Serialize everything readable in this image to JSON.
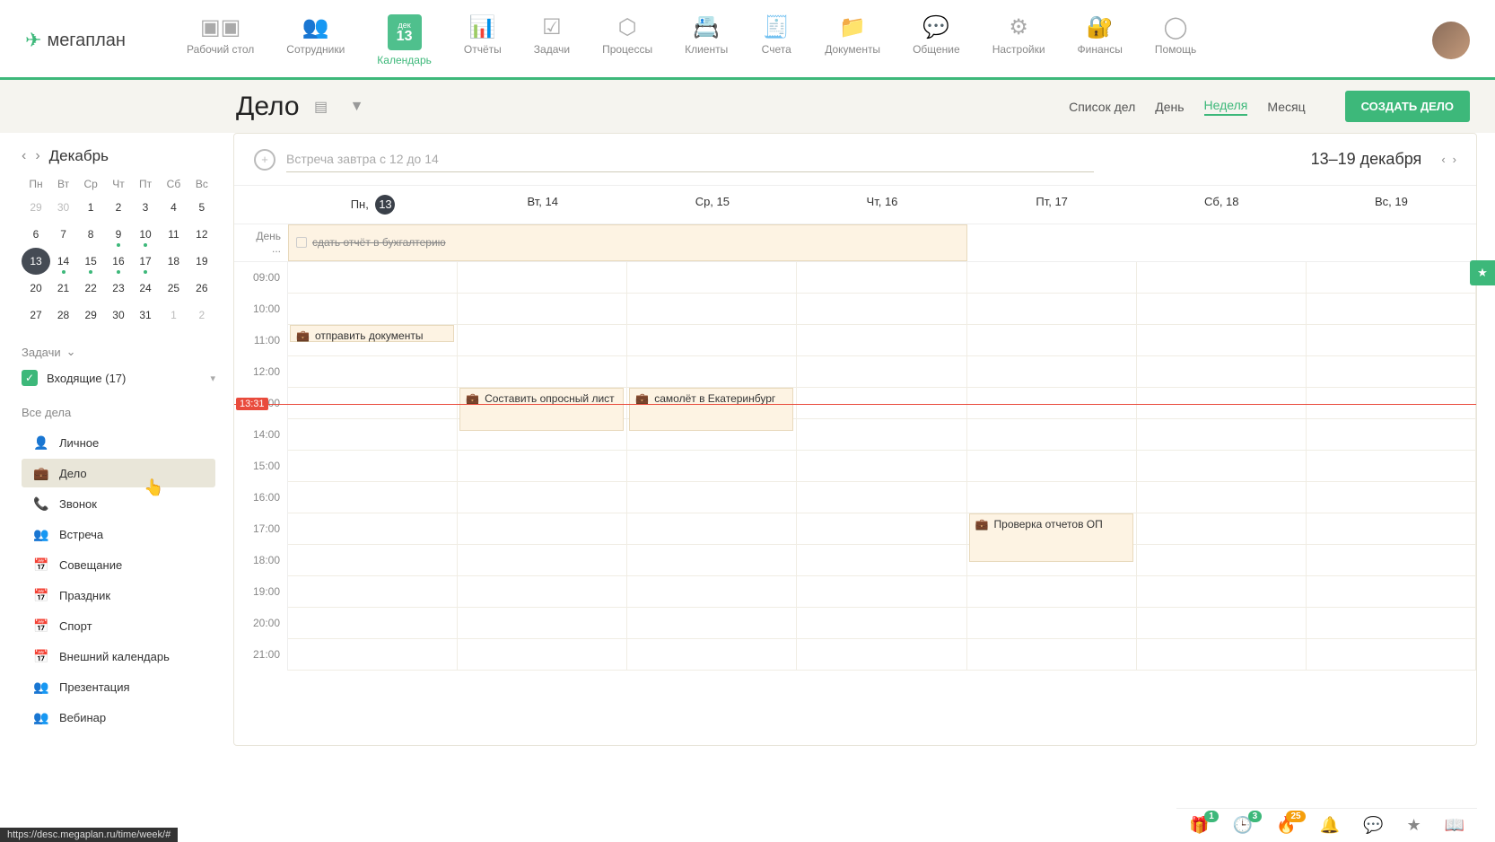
{
  "app": {
    "logo": "мегаплан"
  },
  "nav": [
    {
      "id": "desktop",
      "label": "Рабочий стол"
    },
    {
      "id": "staff",
      "label": "Сотрудники"
    },
    {
      "id": "calendar",
      "label": "Календарь",
      "active": true,
      "cal_month": "дек",
      "cal_day": "13"
    },
    {
      "id": "reports",
      "label": "Отчёты"
    },
    {
      "id": "tasks",
      "label": "Задачи"
    },
    {
      "id": "processes",
      "label": "Процессы"
    },
    {
      "id": "clients",
      "label": "Клиенты"
    },
    {
      "id": "invoices",
      "label": "Счета"
    },
    {
      "id": "documents",
      "label": "Документы"
    },
    {
      "id": "chat",
      "label": "Общение"
    },
    {
      "id": "settings",
      "label": "Настройки"
    },
    {
      "id": "finance",
      "label": "Финансы"
    },
    {
      "id": "help",
      "label": "Помощь"
    }
  ],
  "page": {
    "title": "Дело"
  },
  "view_tabs": {
    "list": "Список дел",
    "day": "День",
    "week": "Неделя",
    "month": "Месяц",
    "active": "week"
  },
  "create_button": "СОЗДАТЬ ДЕЛО",
  "sidebar": {
    "month": "Декабрь",
    "dow": [
      "Пн",
      "Вт",
      "Ср",
      "Чт",
      "Пт",
      "Сб",
      "Вс"
    ],
    "weeks": [
      [
        {
          "d": "29",
          "m": true
        },
        {
          "d": "30",
          "m": true
        },
        {
          "d": "1"
        },
        {
          "d": "2"
        },
        {
          "d": "3"
        },
        {
          "d": "4"
        },
        {
          "d": "5"
        }
      ],
      [
        {
          "d": "6"
        },
        {
          "d": "7"
        },
        {
          "d": "8"
        },
        {
          "d": "9",
          "dot": true
        },
        {
          "d": "10",
          "dot": true
        },
        {
          "d": "11"
        },
        {
          "d": "12"
        }
      ],
      [
        {
          "d": "13",
          "today": true
        },
        {
          "d": "14",
          "dot": true
        },
        {
          "d": "15",
          "dot": true
        },
        {
          "d": "16",
          "dot": true
        },
        {
          "d": "17",
          "dot": true
        },
        {
          "d": "18"
        },
        {
          "d": "19"
        }
      ],
      [
        {
          "d": "20"
        },
        {
          "d": "21"
        },
        {
          "d": "22"
        },
        {
          "d": "23"
        },
        {
          "d": "24"
        },
        {
          "d": "25"
        },
        {
          "d": "26"
        }
      ],
      [
        {
          "d": "27"
        },
        {
          "d": "28"
        },
        {
          "d": "29"
        },
        {
          "d": "30"
        },
        {
          "d": "31"
        },
        {
          "d": "1",
          "m": true
        },
        {
          "d": "2",
          "m": true
        }
      ]
    ],
    "tasks_label": "Задачи",
    "inbox_label": "Входящие (17)",
    "all_label": "Все дела",
    "categories": [
      {
        "id": "personal",
        "label": "Личное",
        "icon": "👤",
        "color": "#666"
      },
      {
        "id": "task",
        "label": "Дело",
        "icon": "💼",
        "color": "#666",
        "selected": true
      },
      {
        "id": "call",
        "label": "Звонок",
        "icon": "📞",
        "color": "#3db87a"
      },
      {
        "id": "meeting",
        "label": "Встреча",
        "icon": "👥",
        "color": "#e94b3c"
      },
      {
        "id": "conference",
        "label": "Совещание",
        "icon": "📅",
        "color": "#4a90d9"
      },
      {
        "id": "holiday",
        "label": "Праздник",
        "icon": "📅",
        "color": "#f5a623"
      },
      {
        "id": "sport",
        "label": "Спорт",
        "icon": "📅",
        "color": "#f5a623"
      },
      {
        "id": "external",
        "label": "Внешний календарь",
        "icon": "📅",
        "color": "#888"
      },
      {
        "id": "presentation",
        "label": "Презентация",
        "icon": "👥",
        "color": "#3db87a"
      },
      {
        "id": "webinar",
        "label": "Вебинар",
        "icon": "👥",
        "color": "#f5a623"
      }
    ]
  },
  "calendar": {
    "quick_placeholder": "Встреча завтра с 12 до 14",
    "range_label": "13–19 декабря",
    "days": [
      "Пн, ",
      "Вт, 14",
      "Ср, 15",
      "Чт, 16",
      "Пт, 17",
      "Сб, 18",
      "Вс, 19"
    ],
    "today_num": "13",
    "allday_label": "День",
    "allday_more": "...",
    "hours": [
      "09:00",
      "10:00",
      "11:00",
      "12:00",
      "13:00",
      "14:00",
      "15:00",
      "16:00",
      "17:00",
      "18:00",
      "19:00",
      "20:00",
      "21:00"
    ],
    "now": "13:31",
    "allday_event": {
      "label": "сдать отчёт в бухгалтерию"
    },
    "events": [
      {
        "col": 0,
        "start": "11:00",
        "end": "11:40",
        "label": "отправить документы"
      },
      {
        "col": 1,
        "start": "13:00",
        "end": "14:30",
        "label": "Составить опросный лист"
      },
      {
        "col": 2,
        "start": "13:00",
        "end": "14:30",
        "label": "самолёт в Екатеринбург"
      },
      {
        "col": 4,
        "start": "17:00",
        "end": "18:40",
        "label": "Проверка отчетов ОП"
      }
    ]
  },
  "tray": [
    {
      "id": "gift",
      "badge": "1"
    },
    {
      "id": "clock",
      "badge": "3"
    },
    {
      "id": "fire",
      "badge": "25",
      "color": "orange"
    },
    {
      "id": "bell"
    },
    {
      "id": "chat"
    },
    {
      "id": "star"
    },
    {
      "id": "book"
    }
  ],
  "status_url": "https://desc.megaplan.ru/time/week/#"
}
